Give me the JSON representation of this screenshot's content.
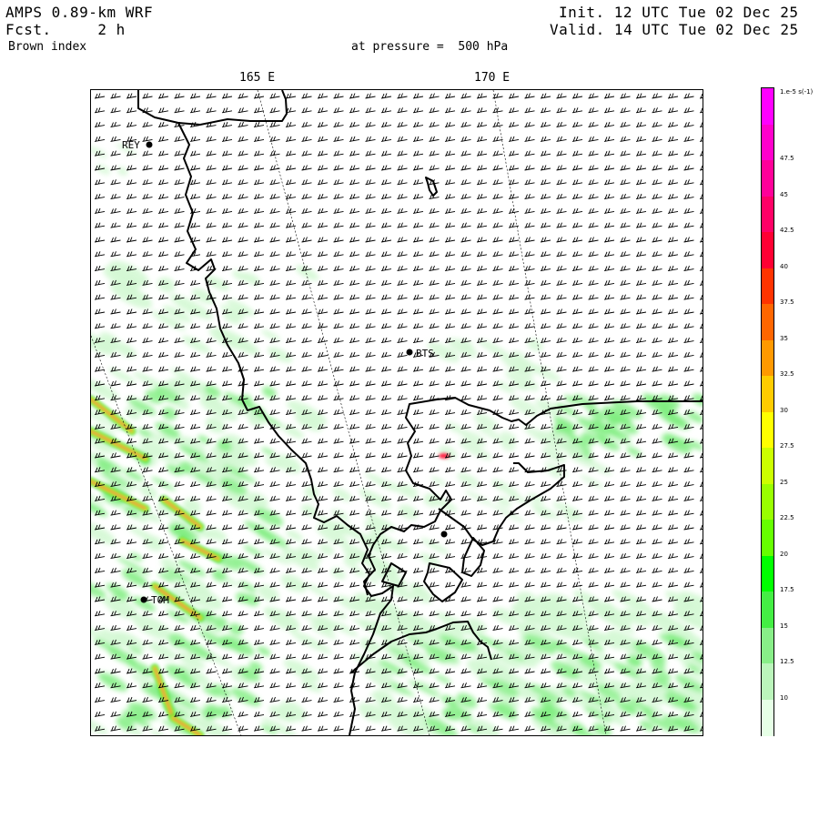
{
  "header": {
    "model": "AMPS 0.89-km WRF",
    "forecast": "Fcst.     2 h",
    "field": "Brown index",
    "init": "Init. 12 UTC Tue 02 Dec 25",
    "valid": "Valid. 14 UTC Tue 02 Dec 25",
    "pressure": "at pressure =  500 hPa"
  },
  "longitude_labels": [
    "165 E",
    "170 E"
  ],
  "stations": [
    {
      "name": "REY",
      "label_visible": true
    },
    {
      "name": "BTS",
      "label_visible": true
    },
    {
      "name": "TOM",
      "label_visible": true
    },
    {
      "name": "",
      "label_visible": false
    }
  ],
  "colorbar": {
    "unit_label": "1.e-5 s(-1)",
    "levels": [
      "47.5",
      "45",
      "42.5",
      "40",
      "37.5",
      "35",
      "32.5",
      "30",
      "27.5",
      "25",
      "22.5",
      "20",
      "17.5",
      "15",
      "12.5",
      "10"
    ],
    "colors": [
      "#ff00ff",
      "#ff00cc",
      "#ff0099",
      "#ff0066",
      "#ff0033",
      "#ff3300",
      "#ff6600",
      "#ff9900",
      "#ffcc00",
      "#ffff00",
      "#ccff00",
      "#99ff00",
      "#66ff00",
      "#00ff00",
      "#44ee44",
      "#88ee88",
      "#bbf5bb",
      "#e6ffe6"
    ]
  },
  "colors": {
    "shading_light": "#d4f8d4",
    "shading_mid": "#7fee7f",
    "shading_strong": "#33dd33",
    "max_core": "#ff2244",
    "coastline": "#000000"
  },
  "wind_barbs": "uniform westerly barbs across entire domain"
}
